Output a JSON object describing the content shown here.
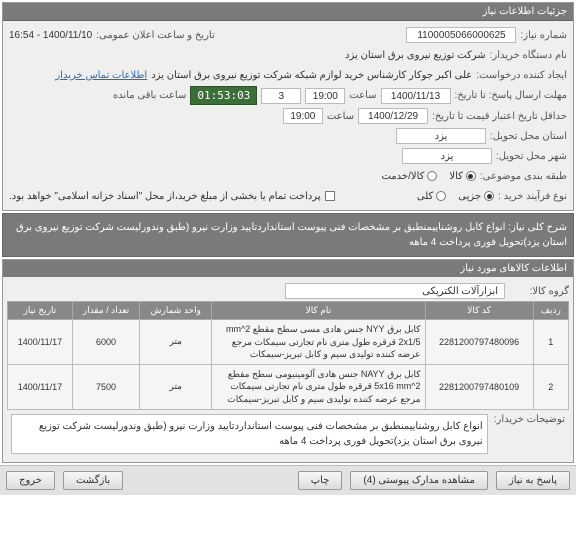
{
  "header": {
    "title": "جزئیات اطلاعات نیاز"
  },
  "info": {
    "need_no_label": "شماره نیاز:",
    "need_no": "1100005066000625",
    "pub_datetime_label": "تاریخ و ساعت اعلان عمومی:",
    "pub_datetime": "1400/11/10 - 16:54",
    "buyer_org_label": "نام دستگاه خریدار:",
    "buyer_org": "شرکت توزیع نیروی برق استان یزد",
    "requester_label": "ایجاد کننده درخواست:",
    "requester": "علی اکبر  جوکار  کارشناس خرید لوازم شبکه  شرکت توزیع نیروی برق استان یزد",
    "contact_link": "اطلاعات تماس خریدار",
    "reply_deadline_label": "مهلت ارسال پاسخ:  تا تاریخ:",
    "reply_deadline_date": "1400/11/13",
    "time_label": "ساعت",
    "reply_deadline_time": "19:00",
    "days": "3",
    "remaining_label": "ساعت باقی مانده",
    "countdown": "01:53:03",
    "validity_label": "حداقل تاریخ اعتبار قیمت تا تاریخ:",
    "validity_date": "1400/12/29",
    "validity_time": "19:00",
    "deliver_province_label": "استان محل تحویل:",
    "deliver_province": "یزد",
    "deliver_city_label": "شهر محل تحویل:",
    "deliver_city": "یزد",
    "class_label": "طبقه بندی موضوعی:",
    "class_radio": {
      "options": [
        "کالا",
        "کالا/خدمت"
      ],
      "selected": 0
    },
    "buy_type_label": "نوع فرآیند خرید :",
    "buy_type_radio": {
      "options": [
        "جزیی",
        "کلی"
      ],
      "selected": 0
    },
    "payment_note": "پرداخت تمام یا بخشی از مبلغ خرید،از محل \"اسناد خزانه اسلامی\" خواهد بود.",
    "payment_chk": false
  },
  "overview": {
    "label": "شرح کلی نیاز:",
    "text": "انواع کابل روشناییمنطبق بر  مشخصات فنی پیوست  استانداردتایید وزارت نیرو (طبق وندورلیست شرکت توزیع نیروی برق استان یزد)تحویل فوری پرداخت 4 ماهه"
  },
  "items": {
    "header": "اطلاعات کالاهای مورد نیاز",
    "group_label": "گروه کالا:",
    "group_value": "ابزارآلات الکتریکی",
    "columns": [
      "تاریخ نیاز",
      "تعداد / مقدار",
      "واحد شمارش",
      "نام کالا",
      "کد کالا",
      "ردیف"
    ],
    "rows": [
      {
        "idx": "1",
        "code": "2281200797480096",
        "name": "کابل برق NYY جنس هادی مسی سطح مقطع mm^2 2x1/5 قرقره طول متری نام تجارتی سیمکات مرجع عرضه کننده تولیدی سیم و کابل تبریز-سیمکات",
        "unit": "متر",
        "qty": "6000",
        "date": "1400/11/17"
      },
      {
        "idx": "2",
        "code": "2281200797480109",
        "name": "کابل برق NAYY جنس هادی آلومینیومی سطح مقطع 5x16 mm^2 قرقره طول متری نام تجارتی سیمکات مرجع عرضه کننده تولیدی سیم و کابل تبریز-سیمکات",
        "unit": "متر",
        "qty": "7500",
        "date": "1400/11/17"
      }
    ]
  },
  "explain": {
    "label": "توضیحات خریدار:",
    "text": "انواع کابل روشناییمنطبق بر  مشخصات فنی پیوست  استانداردتایید وزارت نیرو (طبق وندورلیست شرکت توزیع نیروی برق استان یزد)تحویل فوری پرداخت 4 ماهه"
  },
  "buttons": {
    "reply": "پاسخ به نیاز",
    "print": "چاپ",
    "docs": "مشاهده مدارک پیوستی (4)",
    "back": "بازگشت",
    "exit": "خروج"
  }
}
